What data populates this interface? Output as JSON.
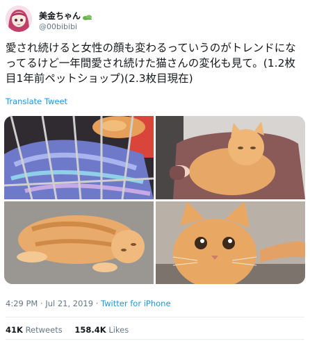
{
  "tweet": {
    "display_name": "美金ちゃん",
    "name_emoji_icon": "four-leaf-clover-icon",
    "handle": "@00bibibi",
    "text": "愛され続けると女性の顔も変わるっていうのがトレンドになってるけど一年間愛され続けた猫さんの変化も見て。(1.2枚目1年前ペットショップ)(2.3枚目現在)",
    "translate_label": "Translate Tweet",
    "time": "4:29 PM",
    "date": "Jul 21, 2019",
    "separator": "·",
    "source": "Twitter for iPhone",
    "retweets_count": "41K",
    "retweets_label": "Retweets",
    "likes_count": "158.4K",
    "likes_label": "Likes"
  },
  "colors": {
    "link": "#1b95e0",
    "muted": "#657786",
    "text": "#14171a",
    "divider": "#e6ecf0"
  }
}
